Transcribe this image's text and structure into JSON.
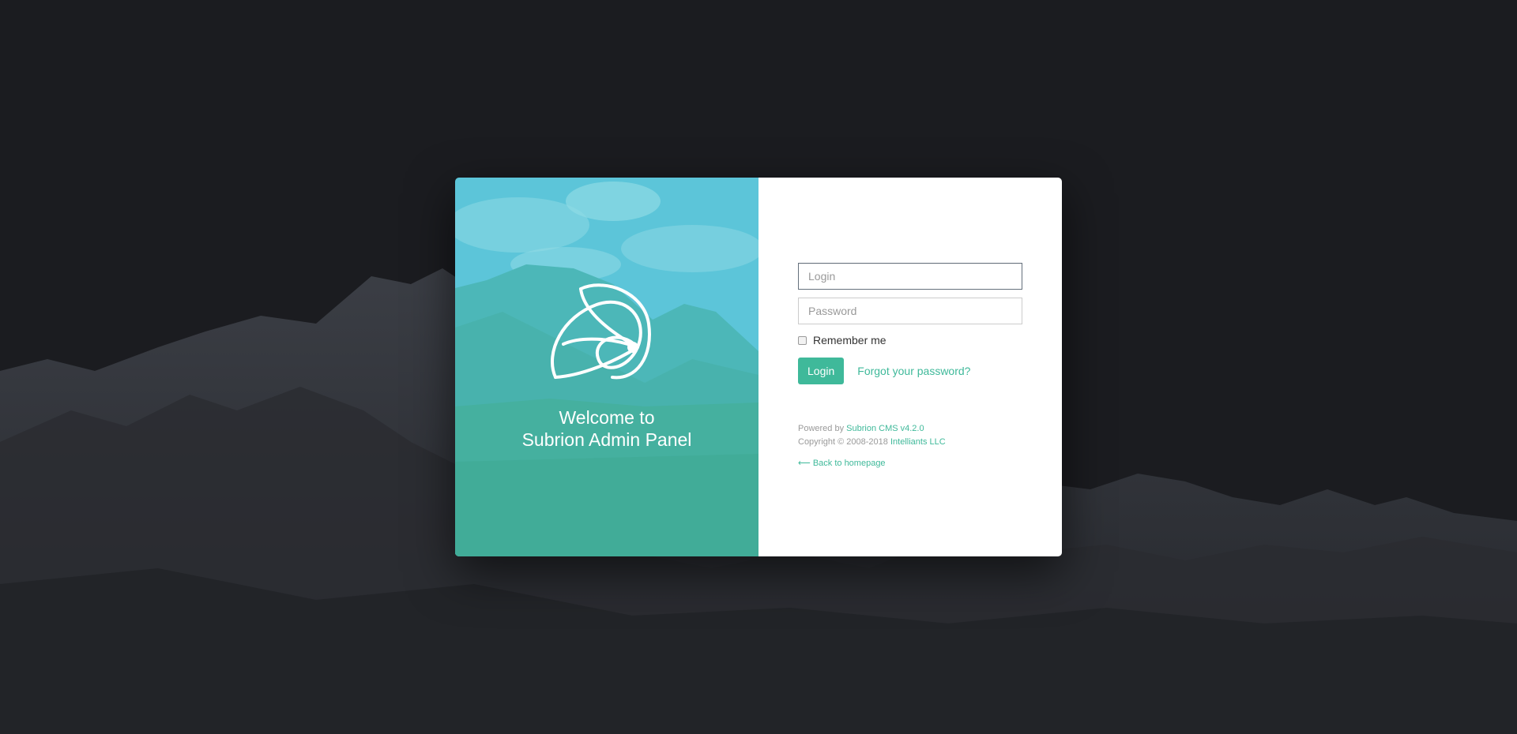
{
  "welcome": {
    "line1": "Welcome to",
    "line2": "Subrion Admin Panel"
  },
  "form": {
    "login_placeholder": "Login",
    "password_placeholder": "Password",
    "remember_label": "Remember me",
    "login_button": "Login",
    "forgot_link": "Forgot your password?"
  },
  "footer": {
    "powered_prefix": "Powered by ",
    "powered_link": "Subrion CMS v4.2.0",
    "copyright_prefix": "Copyright © 2008-2018 ",
    "copyright_link": "Intelliants LLC",
    "back_link": "⟵ Back to homepage"
  },
  "icons": {
    "logo": "subrion-logo-icon",
    "checkbox": "checkbox-icon"
  },
  "colors": {
    "accent": "#3fb99a",
    "page_background": "#1b1c20",
    "overlay": "#4ec3c8"
  }
}
